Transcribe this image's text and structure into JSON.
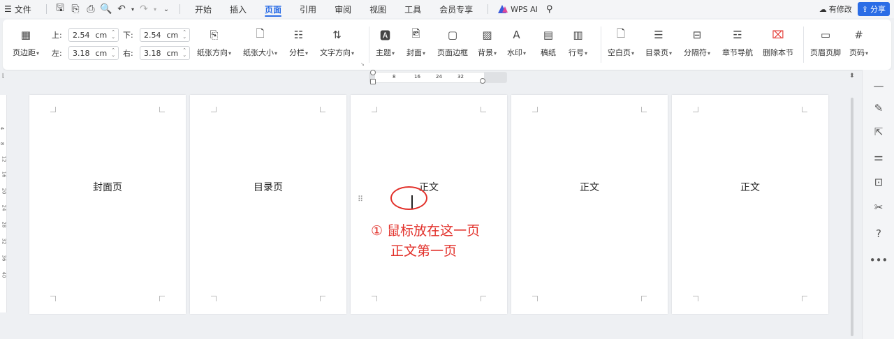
{
  "menubar": {
    "file_label": "文件",
    "tabs": [
      "开始",
      "插入",
      "页面",
      "引用",
      "审阅",
      "视图",
      "工具",
      "会员专享"
    ],
    "active_tab": "页面",
    "wps_ai": "WPS AI",
    "modified_label": "有修改",
    "share_label": "分享"
  },
  "ribbon": {
    "margins_button": "页边距",
    "margin_top_label": "上:",
    "margin_top_value": "2.54",
    "margin_bottom_label": "下:",
    "margin_bottom_value": "2.54",
    "margin_left_label": "左:",
    "margin_left_value": "3.18",
    "margin_right_label": "右:",
    "margin_right_value": "3.18",
    "unit": "cm",
    "orientation": "纸张方向",
    "size": "纸张大小",
    "columns": "分栏",
    "text_direction": "文字方向",
    "theme": "主题",
    "cover": "封面",
    "page_border": "页面边框",
    "background": "背景",
    "watermark": "水印",
    "manuscript": "稿纸",
    "line_number": "行号",
    "blank_page": "空白页",
    "toc_page": "目录页",
    "separator": "分隔符",
    "chapter_nav": "章节导航",
    "delete_section": "删除本节",
    "header_footer": "页眉页脚",
    "page_number": "页码"
  },
  "ruler": {
    "ticks": [
      "8",
      "16",
      "24",
      "32"
    ]
  },
  "vruler": {
    "ticks": [
      "4",
      "8",
      "12",
      "16",
      "20",
      "24",
      "28",
      "32",
      "36",
      "40"
    ]
  },
  "pages": [
    {
      "title": "封面页"
    },
    {
      "title": "目录页"
    },
    {
      "title": "正文"
    },
    {
      "title": "正文"
    },
    {
      "title": "正文"
    }
  ],
  "annotation": {
    "line1": "① 鼠标放在这一页",
    "line2": "正文第一页",
    "color": "#e2302a"
  },
  "colors": {
    "accent": "#2b6de6",
    "annotation": "#e2302a"
  }
}
